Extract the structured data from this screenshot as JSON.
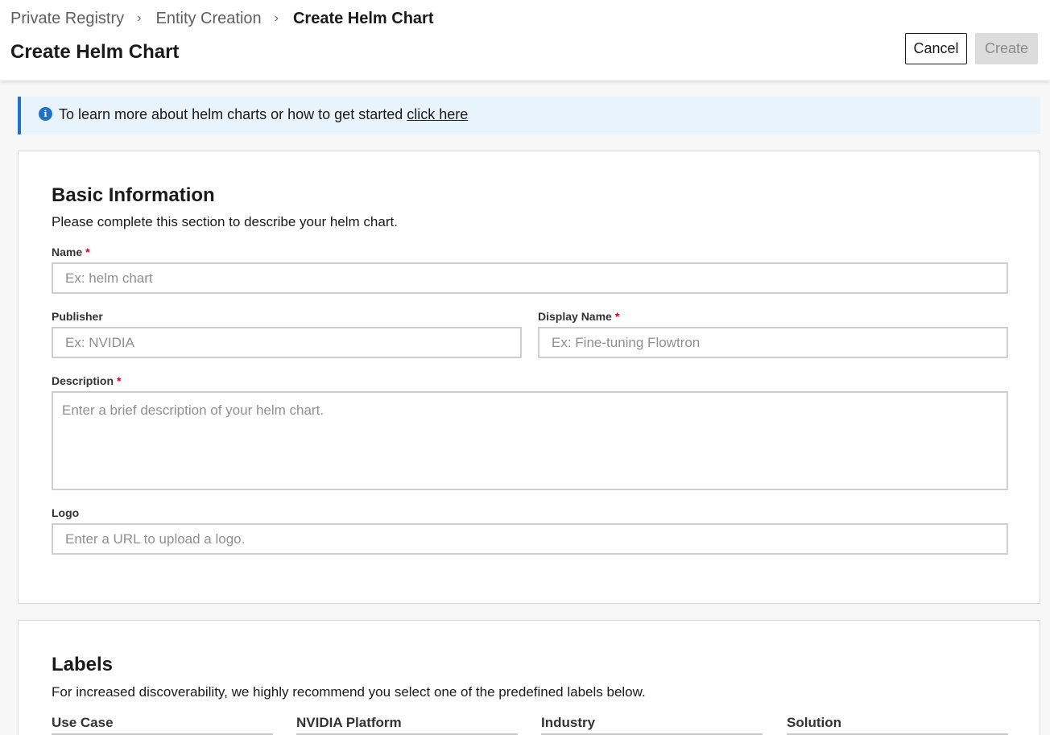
{
  "breadcrumb": {
    "items": [
      "Private Registry",
      "Entity Creation",
      "Create Helm Chart"
    ],
    "separator": "›"
  },
  "header": {
    "title": "Create Helm Chart",
    "cancel_label": "Cancel",
    "create_label": "Create"
  },
  "banner": {
    "icon": "info-icon",
    "text": "To learn more about helm charts or how to get started ",
    "link_text": "click here"
  },
  "basic": {
    "title": "Basic Information",
    "description": "Please complete this section to describe your helm chart.",
    "required_marker": "*",
    "name": {
      "label": "Name",
      "placeholder": "Ex: helm chart",
      "value": ""
    },
    "publisher": {
      "label": "Publisher",
      "placeholder": "Ex: NVIDIA",
      "value": ""
    },
    "display_name": {
      "label": "Display Name",
      "placeholder": "Ex: Fine-tuning Flowtron",
      "value": ""
    },
    "description_field": {
      "label": "Description",
      "placeholder": "Enter a brief description of your helm chart.",
      "value": ""
    },
    "logo": {
      "label": "Logo",
      "placeholder": "Enter a URL to upload a logo.",
      "value": ""
    }
  },
  "labels": {
    "title": "Labels",
    "description": "For increased discoverability, we highly recommend you select one of the predefined labels below.",
    "columns": [
      "Use Case",
      "NVIDIA Platform",
      "Industry",
      "Solution"
    ]
  },
  "colors": {
    "accent_blue": "#2171c7",
    "banner_bg": "#e8f3fb",
    "required_red": "#d0021b",
    "disabled_bg": "#dcdcdc"
  }
}
